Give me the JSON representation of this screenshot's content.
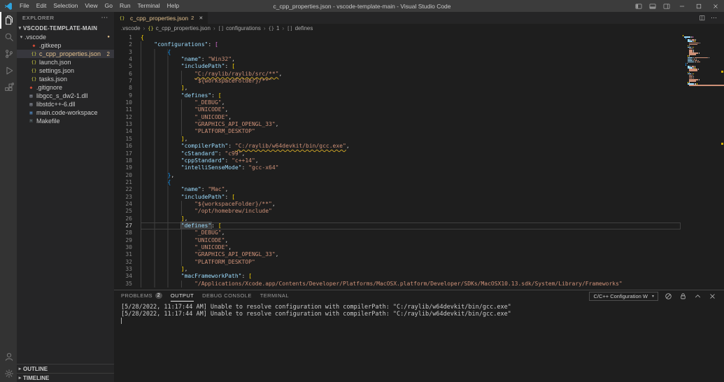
{
  "window": {
    "title": "c_cpp_properties.json - vscode-template-main - Visual Studio Code",
    "menus": [
      "File",
      "Edit",
      "Selection",
      "View",
      "Go",
      "Run",
      "Terminal",
      "Help"
    ]
  },
  "activity_bar": {
    "items": [
      {
        "name": "explorer",
        "active": true
      },
      {
        "name": "search"
      },
      {
        "name": "source-control"
      },
      {
        "name": "run-and-debug"
      },
      {
        "name": "extensions"
      }
    ],
    "bottom": [
      {
        "name": "accounts"
      },
      {
        "name": "settings"
      }
    ]
  },
  "sidebar": {
    "header": "EXPLORER",
    "section": "VSCODE-TEMPLATE-MAIN",
    "tree": [
      {
        "label": ".vscode",
        "type": "folder",
        "indent": 0,
        "dot": true
      },
      {
        "label": ".gitkeep",
        "type": "git",
        "indent": 1
      },
      {
        "label": "c_cpp_properties.json",
        "type": "json",
        "indent": 1,
        "selected": true,
        "modified": true,
        "badge": "2"
      },
      {
        "label": "launch.json",
        "type": "json",
        "indent": 1
      },
      {
        "label": "settings.json",
        "type": "json",
        "indent": 1
      },
      {
        "label": "tasks.json",
        "type": "json",
        "indent": 1
      },
      {
        "label": ".gitignore",
        "type": "git",
        "indent": 0
      },
      {
        "label": "libgcc_s_dw2-1.dll",
        "type": "binary",
        "indent": 0
      },
      {
        "label": "libstdc++-6.dll",
        "type": "binary",
        "indent": 0
      },
      {
        "label": "main.code-workspace",
        "type": "workspace",
        "indent": 0
      },
      {
        "label": "Makefile",
        "type": "makefile",
        "indent": 0
      }
    ],
    "outline": "OUTLINE",
    "timeline": "TIMELINE"
  },
  "editor": {
    "tab": {
      "label": "c_cpp_properties.json",
      "badge": "2"
    },
    "breadcrumbs": [
      {
        "label": ".vscode"
      },
      {
        "label": "c_cpp_properties.json",
        "icon": "json"
      },
      {
        "label": "configurations",
        "icon": "array"
      },
      {
        "label": "1",
        "icon": "object"
      },
      {
        "label": "defines",
        "icon": "array"
      }
    ],
    "overview_marks": [
      6,
      16
    ],
    "lines": [
      {
        "n": 1,
        "i": 0,
        "t": [
          [
            "b1",
            "{"
          ]
        ]
      },
      {
        "n": 2,
        "i": 1,
        "t": [
          [
            "k",
            "\"configurations\""
          ],
          [
            "p",
            ": "
          ],
          [
            "b2",
            "["
          ]
        ]
      },
      {
        "n": 3,
        "i": 2,
        "t": [
          [
            "b3",
            "{"
          ]
        ]
      },
      {
        "n": 4,
        "i": 3,
        "t": [
          [
            "k",
            "\"name\""
          ],
          [
            "p",
            ": "
          ],
          [
            "s",
            "\"Win32\""
          ],
          [
            "p",
            ","
          ]
        ]
      },
      {
        "n": 5,
        "i": 3,
        "t": [
          [
            "k",
            "\"includePath\""
          ],
          [
            "p",
            ": "
          ],
          [
            "b1",
            "["
          ]
        ]
      },
      {
        "n": 6,
        "i": 4,
        "t": [
          [
            "su",
            "\"C:/raylib/raylib/src/**\""
          ],
          [
            "p",
            ","
          ]
        ]
      },
      {
        "n": 7,
        "i": 4,
        "t": [
          [
            "s",
            "\"${workspaceFolder}/**\""
          ]
        ]
      },
      {
        "n": 8,
        "i": 3,
        "t": [
          [
            "b1",
            "]"
          ],
          [
            "p",
            ","
          ]
        ]
      },
      {
        "n": 9,
        "i": 3,
        "t": [
          [
            "k",
            "\"defines\""
          ],
          [
            "p",
            ": "
          ],
          [
            "b1",
            "["
          ]
        ]
      },
      {
        "n": 10,
        "i": 4,
        "t": [
          [
            "s",
            "\"_DEBUG\""
          ],
          [
            "p",
            ","
          ]
        ]
      },
      {
        "n": 11,
        "i": 4,
        "t": [
          [
            "s",
            "\"UNICODE\""
          ],
          [
            "p",
            ","
          ]
        ]
      },
      {
        "n": 12,
        "i": 4,
        "t": [
          [
            "s",
            "\"_UNICODE\""
          ],
          [
            "p",
            ","
          ]
        ]
      },
      {
        "n": 13,
        "i": 4,
        "t": [
          [
            "s",
            "\"GRAPHICS_API_OPENGL_33\""
          ],
          [
            "p",
            ","
          ]
        ]
      },
      {
        "n": 14,
        "i": 4,
        "t": [
          [
            "s",
            "\"PLATFORM_DESKTOP\""
          ]
        ]
      },
      {
        "n": 15,
        "i": 3,
        "t": [
          [
            "b1",
            "]"
          ],
          [
            "p",
            ","
          ]
        ]
      },
      {
        "n": 16,
        "i": 3,
        "t": [
          [
            "k",
            "\"compilerPath\""
          ],
          [
            "p",
            ": "
          ],
          [
            "su",
            "\"C:/raylib/w64devkit/bin/gcc.exe\""
          ],
          [
            "p",
            ","
          ]
        ]
      },
      {
        "n": 17,
        "i": 3,
        "t": [
          [
            "k",
            "\"cStandard\""
          ],
          [
            "p",
            ": "
          ],
          [
            "s",
            "\"c99\""
          ],
          [
            "p",
            ","
          ]
        ]
      },
      {
        "n": 18,
        "i": 3,
        "t": [
          [
            "k",
            "\"cppStandard\""
          ],
          [
            "p",
            ": "
          ],
          [
            "s",
            "\"c++14\""
          ],
          [
            "p",
            ","
          ]
        ]
      },
      {
        "n": 19,
        "i": 3,
        "t": [
          [
            "k",
            "\"intelliSenseMode\""
          ],
          [
            "p",
            ": "
          ],
          [
            "s",
            "\"gcc-x64\""
          ]
        ]
      },
      {
        "n": 20,
        "i": 2,
        "t": [
          [
            "b3",
            "}"
          ],
          [
            "p",
            ","
          ]
        ]
      },
      {
        "n": 21,
        "i": 2,
        "t": [
          [
            "b3",
            "{"
          ]
        ]
      },
      {
        "n": 22,
        "i": 3,
        "t": [
          [
            "k",
            "\"name\""
          ],
          [
            "p",
            ": "
          ],
          [
            "s",
            "\"Mac\""
          ],
          [
            "p",
            ","
          ]
        ]
      },
      {
        "n": 23,
        "i": 3,
        "t": [
          [
            "k",
            "\"includePath\""
          ],
          [
            "p",
            ": "
          ],
          [
            "b1",
            "["
          ]
        ]
      },
      {
        "n": 24,
        "i": 4,
        "t": [
          [
            "s",
            "\"${workspaceFolder}/**\""
          ],
          [
            "p",
            ","
          ]
        ]
      },
      {
        "n": 25,
        "i": 4,
        "t": [
          [
            "s",
            "\"/opt/homebrew/include\""
          ]
        ]
      },
      {
        "n": 26,
        "i": 3,
        "t": [
          [
            "b1",
            "]"
          ],
          [
            "p",
            ","
          ]
        ]
      },
      {
        "n": 27,
        "i": 3,
        "a": true,
        "t": [
          [
            "kh",
            "\"defines\""
          ],
          [
            "p",
            ": "
          ],
          [
            "b1",
            "["
          ]
        ]
      },
      {
        "n": 28,
        "i": 4,
        "t": [
          [
            "s",
            "\"_DEBUG\""
          ],
          [
            "p",
            ","
          ]
        ]
      },
      {
        "n": 29,
        "i": 4,
        "t": [
          [
            "s",
            "\"UNICODE\""
          ],
          [
            "p",
            ","
          ]
        ]
      },
      {
        "n": 30,
        "i": 4,
        "t": [
          [
            "s",
            "\"_UNICODE\""
          ],
          [
            "p",
            ","
          ]
        ]
      },
      {
        "n": 31,
        "i": 4,
        "t": [
          [
            "s",
            "\"GRAPHICS_API_OPENGL_33\""
          ],
          [
            "p",
            ","
          ]
        ]
      },
      {
        "n": 32,
        "i": 4,
        "t": [
          [
            "s",
            "\"PLATFORM_DESKTOP\""
          ]
        ]
      },
      {
        "n": 33,
        "i": 3,
        "t": [
          [
            "b1",
            "]"
          ],
          [
            "p",
            ","
          ]
        ]
      },
      {
        "n": 34,
        "i": 3,
        "t": [
          [
            "k",
            "\"macFrameworkPath\""
          ],
          [
            "p",
            ": "
          ],
          [
            "b1",
            "["
          ]
        ]
      },
      {
        "n": 35,
        "i": 4,
        "t": [
          [
            "s",
            "\"/Applications/Xcode.app/Contents/Developer/Platforms/MacOSX.platform/Developer/SDKs/MacOSX10.13.sdk/System/Library/Frameworks\""
          ]
        ]
      }
    ]
  },
  "panel": {
    "tabs": [
      {
        "label": "PROBLEMS",
        "badge": "2"
      },
      {
        "label": "OUTPUT",
        "active": true
      },
      {
        "label": "DEBUG CONSOLE"
      },
      {
        "label": "TERMINAL"
      }
    ],
    "channel_select": "C/C++ Configuration W",
    "output_lines": [
      "[5/28/2022, 11:17:44 AM] Unable to resolve configuration with compilerPath: \"C:/raylib/w64devkit/bin/gcc.exe\"",
      "[5/28/2022, 11:17:44 AM] Unable to resolve configuration with compilerPath: \"C:/raylib/w64devkit/bin/gcc.exe\""
    ]
  },
  "colors": {
    "modified": "#e2c08d",
    "json_key": "#9cdcfe",
    "json_string": "#ce9178",
    "bracket_gold": "#ffd700",
    "warning": "#cca700"
  }
}
